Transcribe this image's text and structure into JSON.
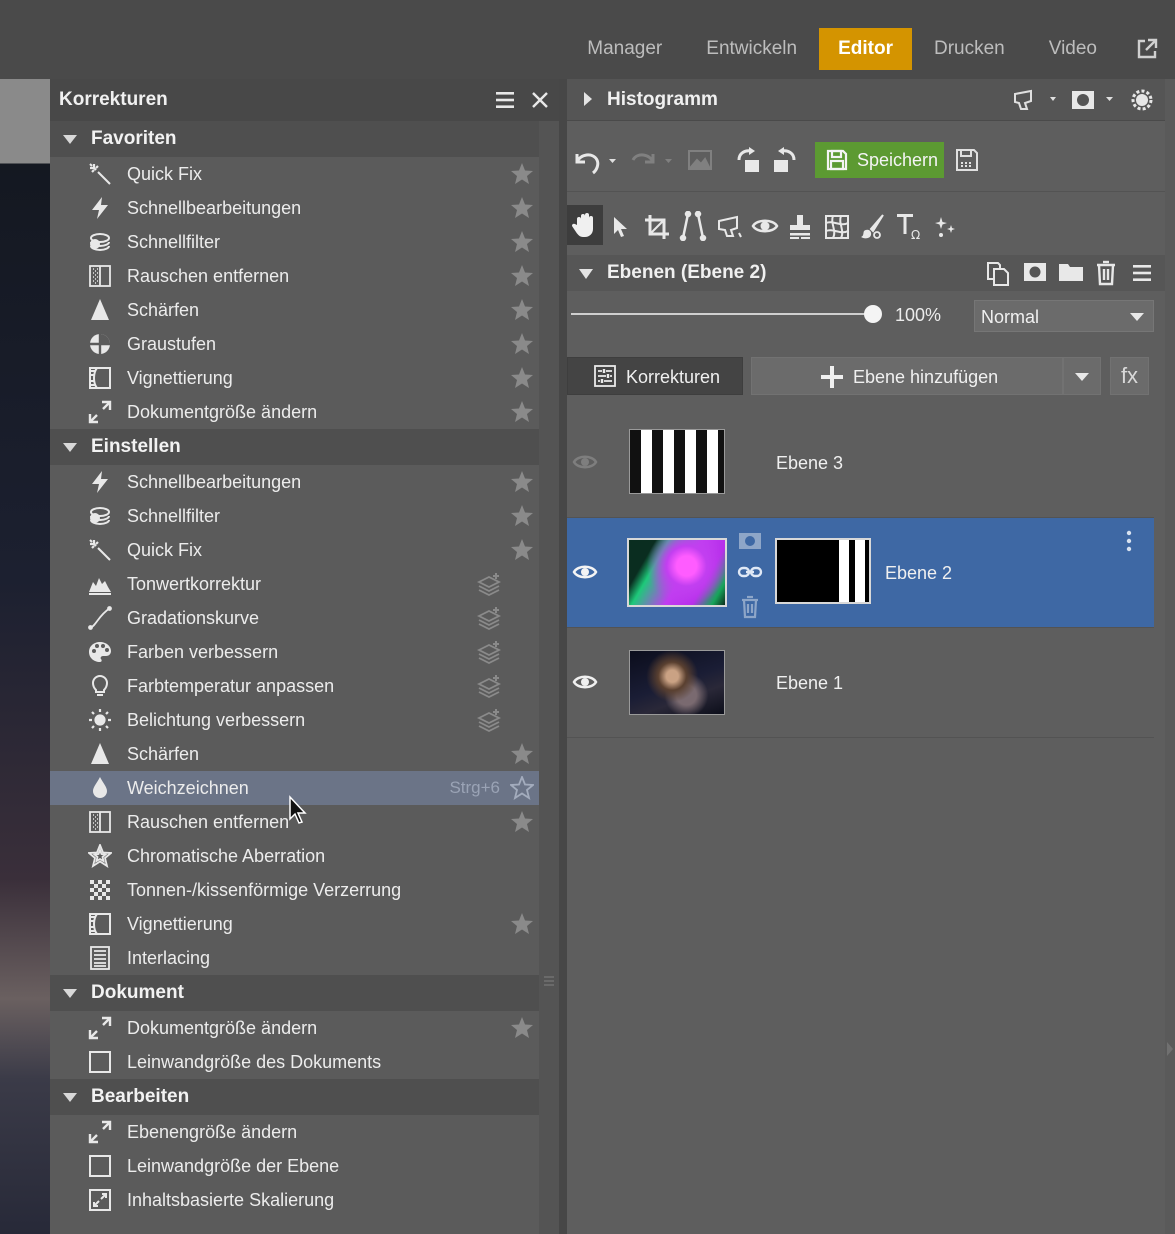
{
  "modes": {
    "manager": "Manager",
    "entwickeln": "Entwickeln",
    "editor": "Editor",
    "drucken": "Drucken",
    "video": "Video"
  },
  "left_panel": {
    "title": "Korrekturen",
    "sections": [
      {
        "title": "Favoriten",
        "items": [
          {
            "label": "Quick Fix",
            "icon": "magic-wand-icon",
            "action": "star"
          },
          {
            "label": "Schnellbearbeitungen",
            "icon": "lightning-icon",
            "action": "star"
          },
          {
            "label": "Schnellfilter",
            "icon": "filter-layers-icon",
            "action": "star"
          },
          {
            "label": "Rauschen entfernen",
            "icon": "noise-icon",
            "action": "star"
          },
          {
            "label": "Schärfen",
            "icon": "sharpen-cone-icon",
            "action": "star"
          },
          {
            "label": "Graustufen",
            "icon": "grayscale-icon",
            "action": "star"
          },
          {
            "label": "Vignettierung",
            "icon": "vignette-icon",
            "action": "star"
          },
          {
            "label": "Dokumentgröße ändern",
            "icon": "resize-arrows-icon",
            "action": "star"
          }
        ]
      },
      {
        "title": "Einstellen",
        "items": [
          {
            "label": "Schnellbearbeitungen",
            "icon": "lightning-icon",
            "action": "star"
          },
          {
            "label": "Schnellfilter",
            "icon": "filter-layers-icon",
            "action": "star"
          },
          {
            "label": "Quick Fix",
            "icon": "magic-wand-icon",
            "action": "star"
          },
          {
            "label": "Tonwertkorrektur",
            "icon": "levels-histogram-icon",
            "action": "add-layer"
          },
          {
            "label": "Gradationskurve",
            "icon": "curve-icon",
            "action": "add-layer"
          },
          {
            "label": "Farben verbessern",
            "icon": "palette-icon",
            "action": "add-layer"
          },
          {
            "label": "Farbtemperatur anpassen",
            "icon": "lightbulb-icon",
            "action": "add-layer"
          },
          {
            "label": "Belichtung verbessern",
            "icon": "sun-icon",
            "action": "add-layer"
          },
          {
            "label": "Schärfen",
            "icon": "sharpen-cone-icon",
            "action": "star"
          },
          {
            "label": "Weichzeichnen",
            "icon": "blur-drop-icon",
            "action": "star-outline",
            "shortcut": "Strg+6",
            "highlighted": true
          },
          {
            "label": "Rauschen entfernen",
            "icon": "noise-icon",
            "action": "star"
          },
          {
            "label": "Chromatische Aberration",
            "icon": "chromatic-star-icon",
            "action": "none"
          },
          {
            "label": "Tonnen-/kissenförmige Verzerrung",
            "icon": "distortion-grid-icon",
            "action": "none"
          },
          {
            "label": "Vignettierung",
            "icon": "vignette-icon",
            "action": "star"
          },
          {
            "label": "Interlacing",
            "icon": "interlacing-icon",
            "action": "none"
          }
        ]
      },
      {
        "title": "Dokument",
        "items": [
          {
            "label": "Dokumentgröße ändern",
            "icon": "resize-arrows-icon",
            "action": "star"
          },
          {
            "label": "Leinwandgröße des Dokuments",
            "icon": "canvas-square-icon",
            "action": "none"
          }
        ]
      },
      {
        "title": "Bearbeiten",
        "items": [
          {
            "label": "Ebenengröße ändern",
            "icon": "resize-arrows-icon",
            "action": "none"
          },
          {
            "label": "Leinwandgröße der Ebene",
            "icon": "canvas-square-icon",
            "action": "none"
          },
          {
            "label": "Inhaltsbasierte Skalierung",
            "icon": "content-aware-scale-icon",
            "action": "none"
          }
        ]
      }
    ]
  },
  "right_panel": {
    "histogram_title": "Histogramm",
    "save_label": "Speichern",
    "layers_title": "Ebenen (Ebene 2)",
    "opacity_value": "100%",
    "opacity_fraction": 1.0,
    "blend_mode": "Normal",
    "korrekturen_button": "Korrekturen",
    "add_layer_button": "Ebene hinzufügen",
    "fx_button": "fx",
    "layers": [
      {
        "name": "Ebene 3",
        "visible": false,
        "selected": false
      },
      {
        "name": "Ebene 2",
        "visible": true,
        "selected": true
      },
      {
        "name": "Ebene 1",
        "visible": true,
        "selected": false
      }
    ]
  },
  "colors": {
    "accent_editor": "#d49400",
    "save_green": "#5c9a32",
    "selected_layer": "#3e68a4",
    "highlight_row": "#6b7487"
  }
}
